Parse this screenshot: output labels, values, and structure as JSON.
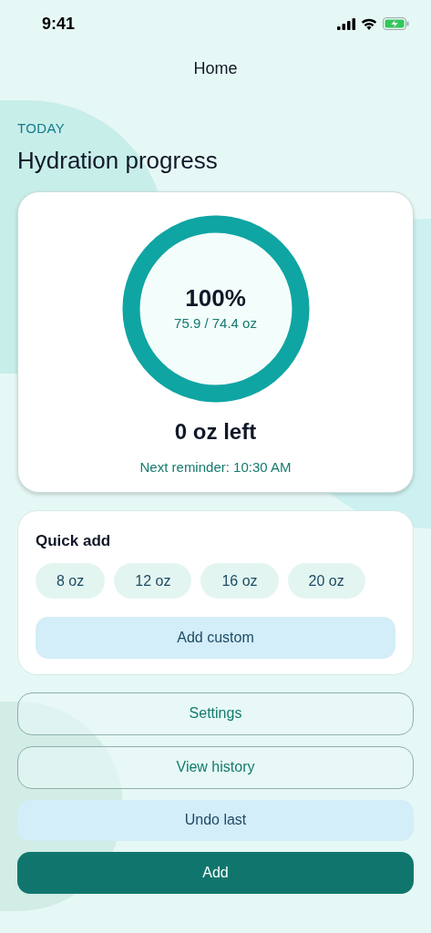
{
  "status_bar": {
    "time": "9:41",
    "battery_charging": true
  },
  "nav": {
    "title": "Home"
  },
  "header": {
    "eyebrow": "TODAY",
    "title": "Hydration progress"
  },
  "progress": {
    "level": 1,
    "percent": "100%",
    "amount": "75.9 / 74.4 oz",
    "remaining": "0 oz left",
    "reminder": "Next reminder: 10:30 AM"
  },
  "quick_add": {
    "title": "Quick add",
    "amounts": [
      "8 oz",
      "12 oz",
      "16 oz",
      "20 oz"
    ],
    "custom": "Add custom"
  },
  "actions": [
    {
      "label": "Settings",
      "kind": "outline"
    },
    {
      "label": "View history",
      "kind": "outline"
    },
    {
      "label": "Undo last",
      "kind": "soft"
    },
    {
      "label": "Add",
      "kind": "primary"
    }
  ]
}
